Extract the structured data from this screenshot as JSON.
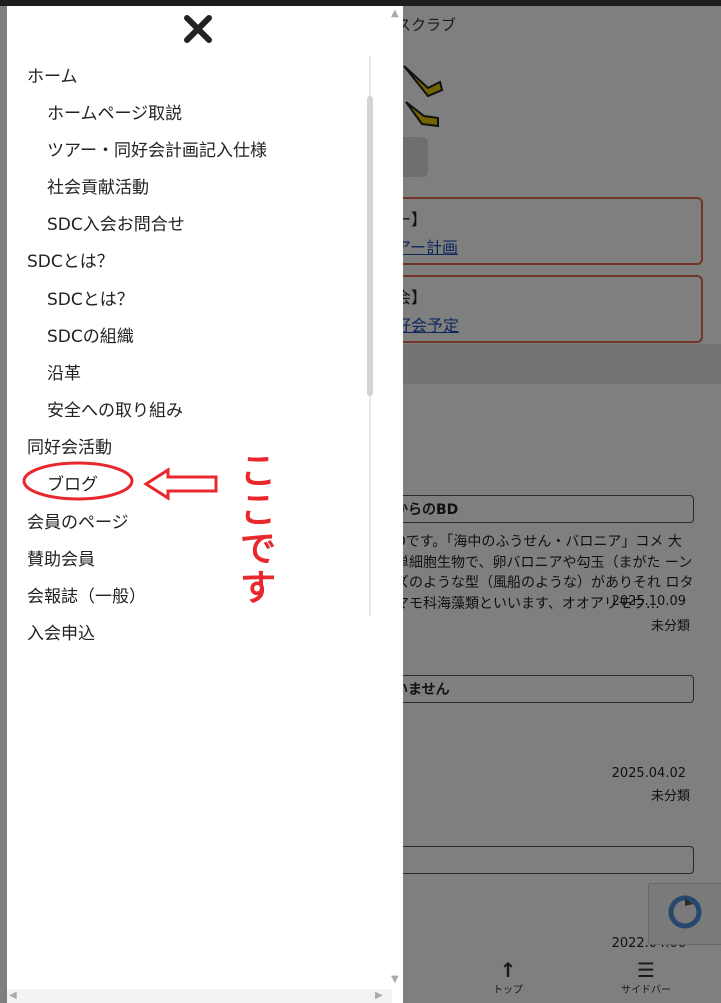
{
  "background": {
    "site_title": "スクラブ",
    "notices": [
      {
        "title": "ー】",
        "link": "アー計画"
      },
      {
        "title": "会】",
        "link": "好会予定"
      }
    ],
    "posts": [
      {
        "title": "からのBD",
        "excerpt": "Dです。「海中のふうせん・バロニア」コメ 大単細胞生物で、卵バロニアや勾玉（まがた ーンズのような型（風船のような）がありそれ ロタマモ科海藻類といいます、オオアリモウ…",
        "date": "2025.10.09",
        "category": "未分類"
      },
      {
        "title": "いません",
        "date": "2025.04.02",
        "category": "未分類"
      },
      {
        "title": "]",
        "date": "2022.04.06"
      }
    ],
    "bottom_bar": [
      {
        "label": "トップ",
        "icon": "arrow-up-icon"
      },
      {
        "label": "サイドバー",
        "icon": "sidebar-menu-icon"
      }
    ]
  },
  "drawer": {
    "close_icon": "close-icon",
    "menu": [
      {
        "label": "ホーム",
        "level": 0
      },
      {
        "label": "ホームページ取説",
        "level": 1
      },
      {
        "label": "ツアー・同好会計画記入仕様",
        "level": 1
      },
      {
        "label": "社会貢献活動",
        "level": 1
      },
      {
        "label": "SDC入会お問合せ",
        "level": 1
      },
      {
        "label": "SDCとは？",
        "level": 0
      },
      {
        "label": "SDCとは？",
        "level": 1
      },
      {
        "label": "SDCの組織",
        "level": 1
      },
      {
        "label": "沿革",
        "level": 1
      },
      {
        "label": "安全への取り組み",
        "level": 1
      },
      {
        "label": "同好会活動",
        "level": 0
      },
      {
        "label": "ブログ",
        "level": 1
      },
      {
        "label": "会員のページ",
        "level": 0
      },
      {
        "label": "賛助会員",
        "level": 0
      },
      {
        "label": "会報誌（一般）",
        "level": 0
      },
      {
        "label": "入会申込",
        "level": 0
      }
    ]
  },
  "annotation": {
    "text": "ここです",
    "color": "#e8282c"
  }
}
